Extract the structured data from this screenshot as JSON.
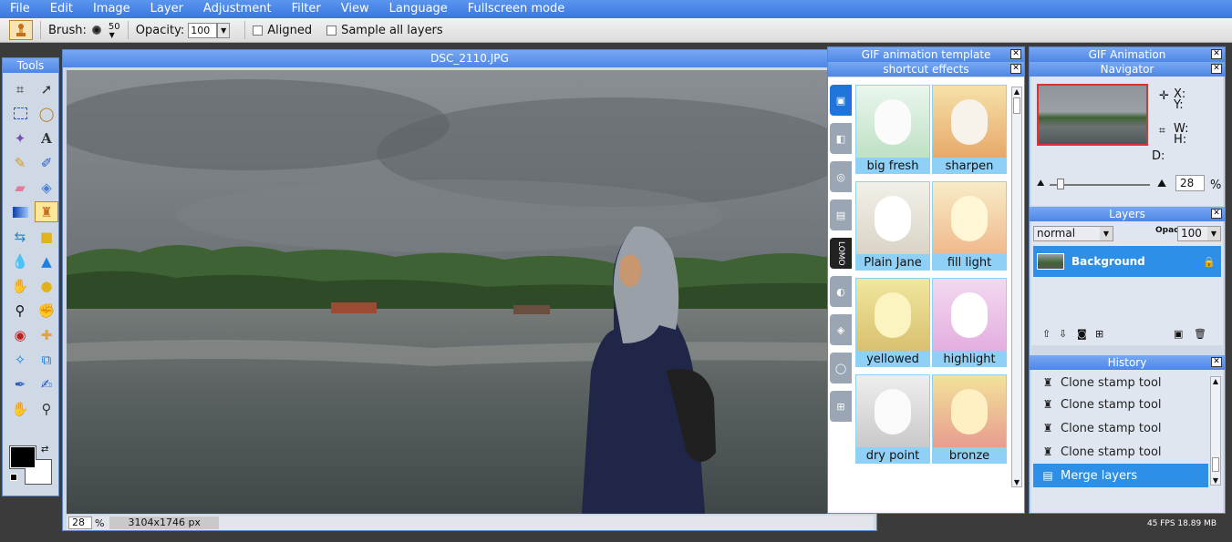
{
  "menu": [
    "File",
    "Edit",
    "Image",
    "Layer",
    "Adjustment",
    "Filter",
    "View",
    "Language",
    "Fullscreen mode"
  ],
  "options": {
    "brush_label": "Brush:",
    "brush_size": "50",
    "opacity_label": "Opacity:",
    "opacity_value": "100",
    "aligned_label": "Aligned",
    "sample_label": "Sample all layers"
  },
  "tools": {
    "title": "Tools",
    "items": [
      "crop-icon",
      "move-icon",
      "marquee-icon",
      "lasso-icon",
      "magic-wand-icon",
      "text-icon",
      "pencil-icon",
      "brush-icon",
      "eraser-icon",
      "paint-bucket-icon",
      "gradient-icon",
      "clone-stamp-icon",
      "color-replace-icon",
      "shape-icon",
      "drop-icon",
      "sharpen-icon",
      "smudge-icon",
      "sponge-icon",
      "burn-icon",
      "dodge-icon",
      "red-eye-icon",
      "spot-heal-icon",
      "bloat-icon",
      "pinch-icon",
      "color-picker-icon",
      "eyedropper-brush-icon",
      "hand-icon",
      "zoom-icon"
    ],
    "active_index": 11
  },
  "canvas": {
    "title": "DSC_2110.JPG",
    "zoom": "28",
    "zoom_unit": "%",
    "dimensions": "3104x1746 px"
  },
  "gif_template": {
    "title": "GIF animation template",
    "effects_title": "shortcut effects",
    "effects": [
      "big fresh",
      "sharpen",
      "Plain Jane",
      "fill light",
      "yellowed",
      "highlight",
      "dry point",
      "bronze"
    ],
    "tab_label": "LOMO"
  },
  "gif_animation": {
    "title": "GIF Animation",
    "navigator_title": "Navigator",
    "x_label": "X:",
    "y_label": "Y:",
    "w_label": "W:",
    "h_label": "H:",
    "d_label": "D:",
    "zoom": "28",
    "zoom_unit": "%"
  },
  "layers": {
    "title": "Layers",
    "blend_mode": "normal",
    "opacity_label": "Opacity:",
    "opacity_value": "100",
    "items": [
      "Background"
    ]
  },
  "history": {
    "title": "History",
    "items": [
      "Clone stamp tool",
      "Clone stamp tool",
      "Clone stamp tool",
      "Clone stamp tool",
      "Merge layers"
    ]
  },
  "footer": "45 FPS 18.89 MB",
  "colors": {
    "accent": "#3a78e0",
    "selection": "#2e8fe6",
    "foreground": "#000000",
    "background": "#ffffff"
  }
}
